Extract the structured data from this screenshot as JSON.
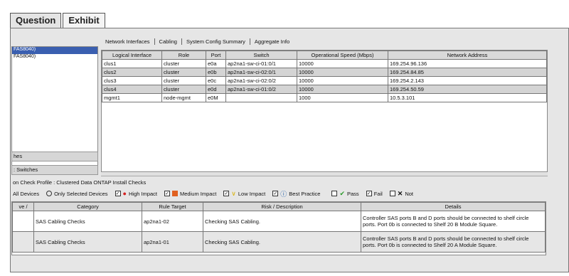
{
  "outer_tabs": [
    "Question",
    "Exhibit"
  ],
  "tree": {
    "items": [
      "FAS8040)",
      "FAS8040)"
    ]
  },
  "left_buttons": [
    "hes",
    ": Switches"
  ],
  "inner_tabs": [
    "Network Interfaces",
    "Cabling",
    "System Config Summary",
    "Aggregate Info"
  ],
  "net_table": {
    "headers": [
      "Logical Interface",
      "Role",
      "Port",
      "Switch",
      "Operational Speed (Mbps)",
      "Network Address"
    ],
    "rows": [
      [
        "clus1",
        "cluster",
        "e0a",
        "ap2na1-sw-ci-01:0/1",
        "10000",
        "169.254.96.136"
      ],
      [
        "clus2",
        "cluster",
        "e0b",
        "ap2na1-sw-ci-02:0/1",
        "10000",
        "169.254.84.85"
      ],
      [
        "clus3",
        "cluster",
        "e0c",
        "ap2na1-sw-ci-02:0/2",
        "10000",
        "169.254.2.143"
      ],
      [
        "clus4",
        "cluster",
        "e0d",
        "ap2na1-sw-ci-01:0/2",
        "10000",
        "169.254.50.59"
      ],
      [
        "mgmt1",
        "node-mgmt",
        "e0M",
        "",
        "1000",
        "10.5.3.101"
      ]
    ]
  },
  "profile_label": "on Check Profile : Clustered Data ONTAP Install Checks",
  "filters": {
    "all_devices": "All Devices",
    "only_selected": "Only Selected Devices",
    "high": "High Impact",
    "medium": "Medium Impact",
    "low": "Low Impact",
    "best": "Best Practice",
    "pass": "Pass",
    "fail": "Fail",
    "not": "Not"
  },
  "check_table": {
    "headers": [
      "ve /",
      "Category",
      "Rule Target",
      "Risk / Description",
      "Details"
    ],
    "rows": [
      [
        "",
        "SAS Cabling Checks",
        "ap2na1-02",
        "Checking SAS Cabling.",
        "Controller SAS ports B and D ports should be connected to shelf circle ports. Port 0b is connected to Shelf 20 B Module Square."
      ],
      [
        "",
        "SAS Cabling Checks",
        "ap2na1-01",
        "Checking SAS Cabling.",
        "Controller SAS ports B and D ports should be connected to shelf circle ports. Port 0b is connected to Shelf 20 A Module Square."
      ]
    ]
  },
  "colors": {
    "selection": "#3a5fb0",
    "high": "#d42020",
    "medium": "#e06020",
    "low": "#d8b000",
    "best": "#1a5aa8",
    "pass": "#2a9a2a"
  }
}
